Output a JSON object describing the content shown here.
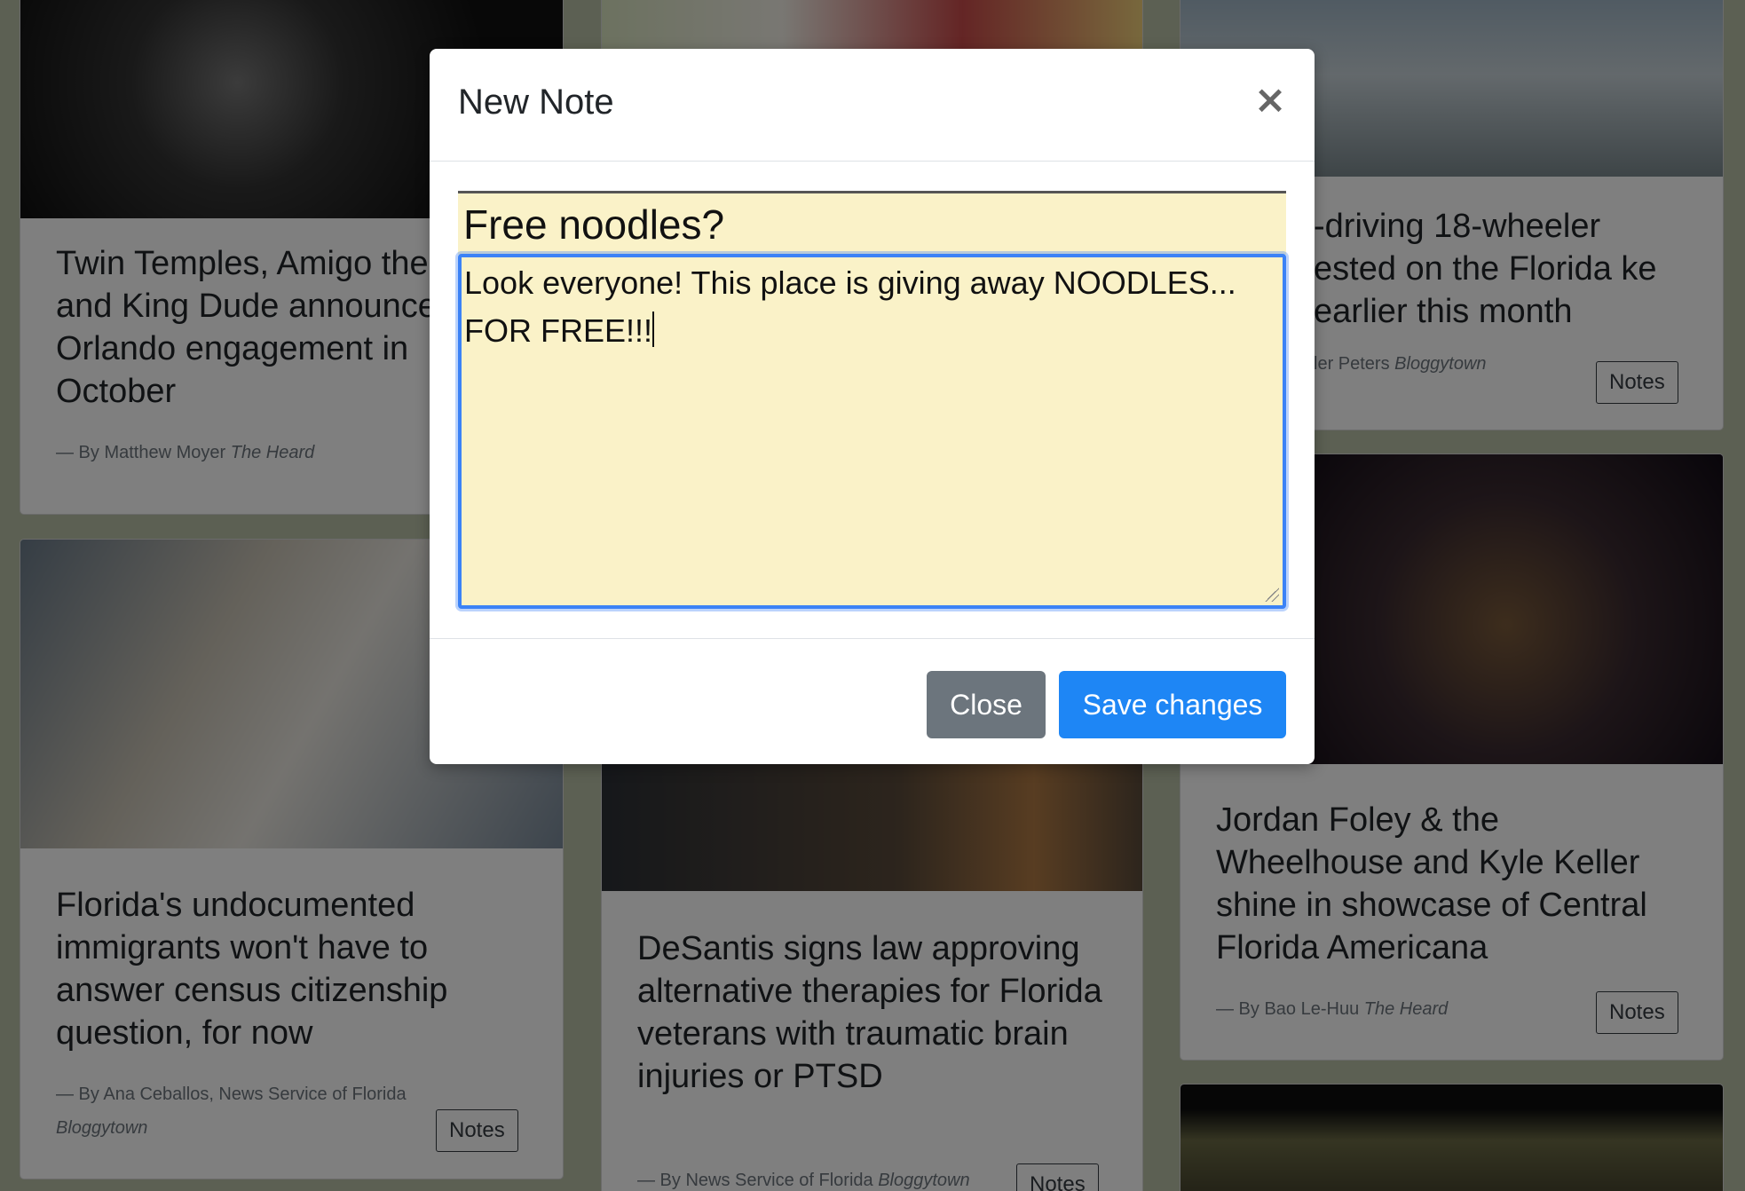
{
  "modal": {
    "title": "New Note",
    "close_glyph": "×",
    "note_title_value": "Free noodles?",
    "note_body_value": "Look everyone! This place is giving away NOODLES...\nFOR FREE!!!",
    "close_button": "Close",
    "save_button": "Save changes"
  },
  "cards": {
    "c1": {
      "title": "Twin Temples, Amigo the Devil and King Dude announce Orlando engagement in October",
      "by": "— By Matthew Moyer",
      "source": "The Heard"
    },
    "c2": {
      "title": "Florida's undocumented immigrants won't have to answer census citizenship question, for now",
      "by": "— By Ana Ceballos, News Service of Florida",
      "source": "Bloggytown",
      "notes": "Notes"
    },
    "c3": {
      "title": "DeSantis signs law approving alternative therapies for Florida veterans with traumatic brain injuries or PTSD",
      "by": "— By News Service of Florida",
      "source": "Bloggytown",
      "notes": "Notes"
    },
    "c4": {
      "title": "-driving 18-wheeler ested on the Florida ke earlier this month",
      "by": "ler Peters",
      "source": "Bloggytown",
      "notes": "Notes"
    },
    "c5": {
      "title": "Jordan Foley & the Wheelhouse and Kyle Keller shine in showcase of Central Florida Americana",
      "by": "— By Bao Le-Huu",
      "source": "The Heard",
      "notes": "Notes"
    }
  },
  "colors": {
    "page_bg": "#b9c0a6",
    "primary": "#1e86f5",
    "secondary": "#6c757d",
    "note_bg": "#faf2c8"
  }
}
